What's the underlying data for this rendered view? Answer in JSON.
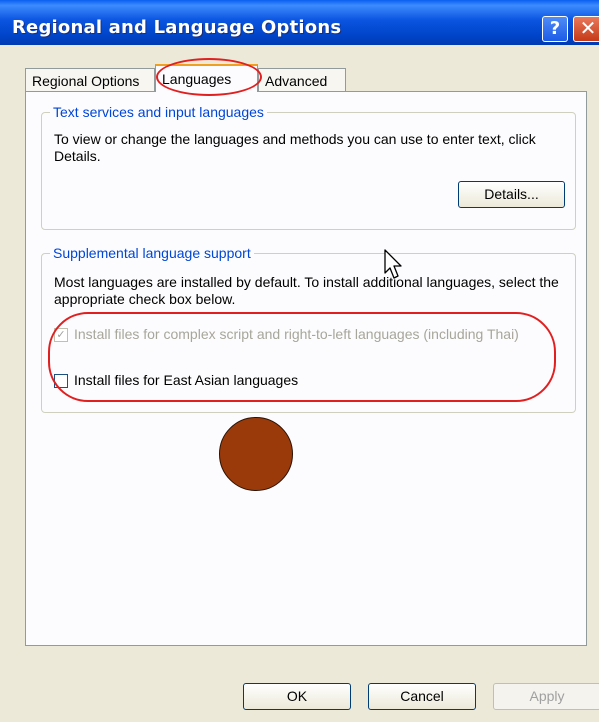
{
  "window": {
    "title": "Regional and Language Options",
    "help_label": "?",
    "close_label": "✕"
  },
  "tabs": [
    {
      "label": "Regional Options",
      "active": false
    },
    {
      "label": "Languages",
      "active": true
    },
    {
      "label": "Advanced",
      "active": false
    }
  ],
  "text_services": {
    "title": "Text services and input languages",
    "description": "To view or change the languages and methods you can use to enter text, click Details.",
    "details_button": "Details..."
  },
  "supplemental": {
    "title": "Supplemental language support",
    "description": "Most languages are installed by default. To install additional languages, select the appropriate check box below.",
    "options": [
      {
        "label": "Install files for complex script and right-to-left languages (including Thai)",
        "checked": true,
        "disabled": true
      },
      {
        "label": "Install files for East Asian languages",
        "checked": false,
        "disabled": false
      }
    ]
  },
  "footer": {
    "ok": "OK",
    "cancel": "Cancel",
    "apply": "Apply"
  },
  "colors": {
    "title_bar": "#0a54e0",
    "group_title": "#0046d5",
    "annotation": "#e02020",
    "marker_dot": "#9a3a0b"
  }
}
